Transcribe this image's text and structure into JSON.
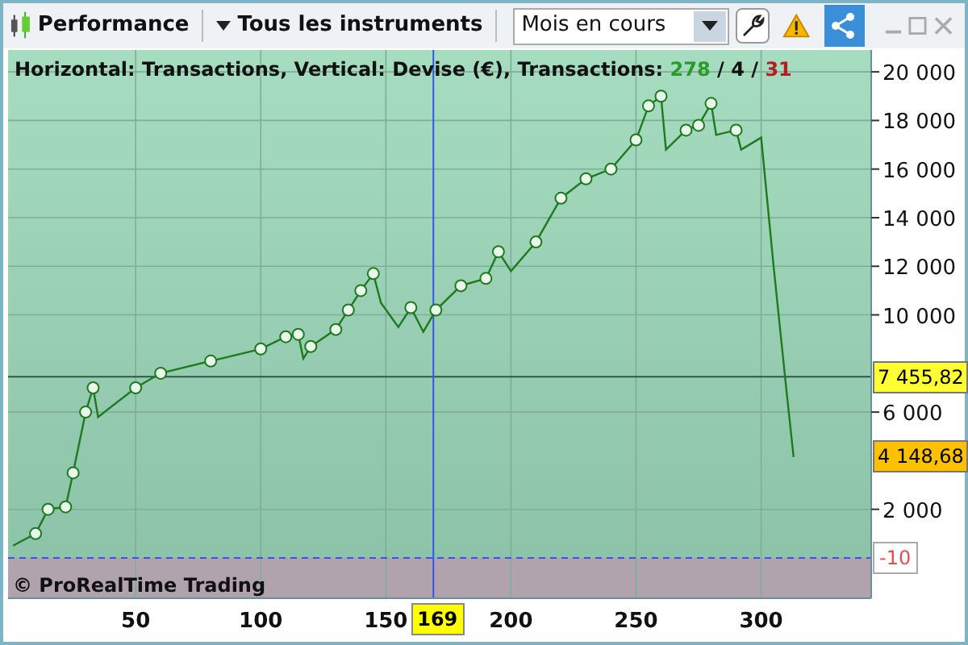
{
  "toolbar": {
    "title": "Performance",
    "instruments": "Tous les instruments",
    "period": {
      "value": "Mois en cours"
    }
  },
  "chart": {
    "legend": {
      "text": "Horizontal: Transactions, Vertical: Devise (€), Transactions:",
      "wins": "278",
      "separator_1": "/",
      "neutral": "4",
      "separator_2": "/",
      "losses": "31"
    },
    "copyright": "© ProRealTime Trading",
    "crosshair_x_label": "169",
    "price_labels": [
      {
        "text": "7 455,82",
        "kind": "line"
      },
      {
        "text": "4 148,68",
        "kind": "last"
      }
    ],
    "baseline_label": "-10",
    "chart_data": {
      "type": "line",
      "x": [
        1,
        10,
        15,
        22,
        25,
        30,
        33,
        35,
        50,
        60,
        80,
        100,
        110,
        115,
        117,
        120,
        130,
        135,
        140,
        145,
        148,
        155,
        160,
        165,
        170,
        180,
        190,
        195,
        200,
        210,
        220,
        230,
        240,
        250,
        255,
        260,
        262,
        270,
        275,
        280,
        282,
        290,
        292,
        300,
        305,
        310,
        313
      ],
      "series": [
        {
          "color": "#1f7a1f",
          "values": [
            500,
            1000,
            2000,
            2100,
            3500,
            6000,
            7000,
            5800,
            7000,
            7600,
            8100,
            8600,
            9100,
            9200,
            8200,
            8700,
            9400,
            10200,
            11000,
            11700,
            10500,
            9500,
            10300,
            9300,
            10200,
            11200,
            11500,
            12600,
            11800,
            13000,
            14800,
            15600,
            16000,
            17200,
            18600,
            19000,
            16800,
            17600,
            17800,
            18700,
            17400,
            17600,
            16800,
            17300,
            12000,
            7000,
            4150
          ]
        }
      ],
      "xlim": [
        -1,
        344
      ],
      "ylim": [
        -1660,
        20900
      ],
      "grid": true,
      "ref_lines": [
        {
          "axis": "y",
          "value": 7455.82,
          "color": "#2c5a3c"
        },
        {
          "axis": "x",
          "value": 169,
          "color": "#3355ee"
        },
        {
          "axis": "y",
          "value": 0,
          "color": "#3355ee"
        }
      ],
      "xticks": [
        50,
        100,
        150,
        200,
        250,
        300
      ],
      "yticks": [
        {
          "value": 2000,
          "label": "2 000"
        },
        {
          "value": 6000,
          "label": "6 000"
        },
        {
          "value": 10000,
          "label": "10 000"
        },
        {
          "value": 12000,
          "label": "12 000"
        },
        {
          "value": 14000,
          "label": "14 000"
        },
        {
          "value": 16000,
          "label": "16 000"
        },
        {
          "value": 18000,
          "label": "18 000"
        },
        {
          "value": 20000,
          "label": "20 000"
        }
      ]
    }
  }
}
